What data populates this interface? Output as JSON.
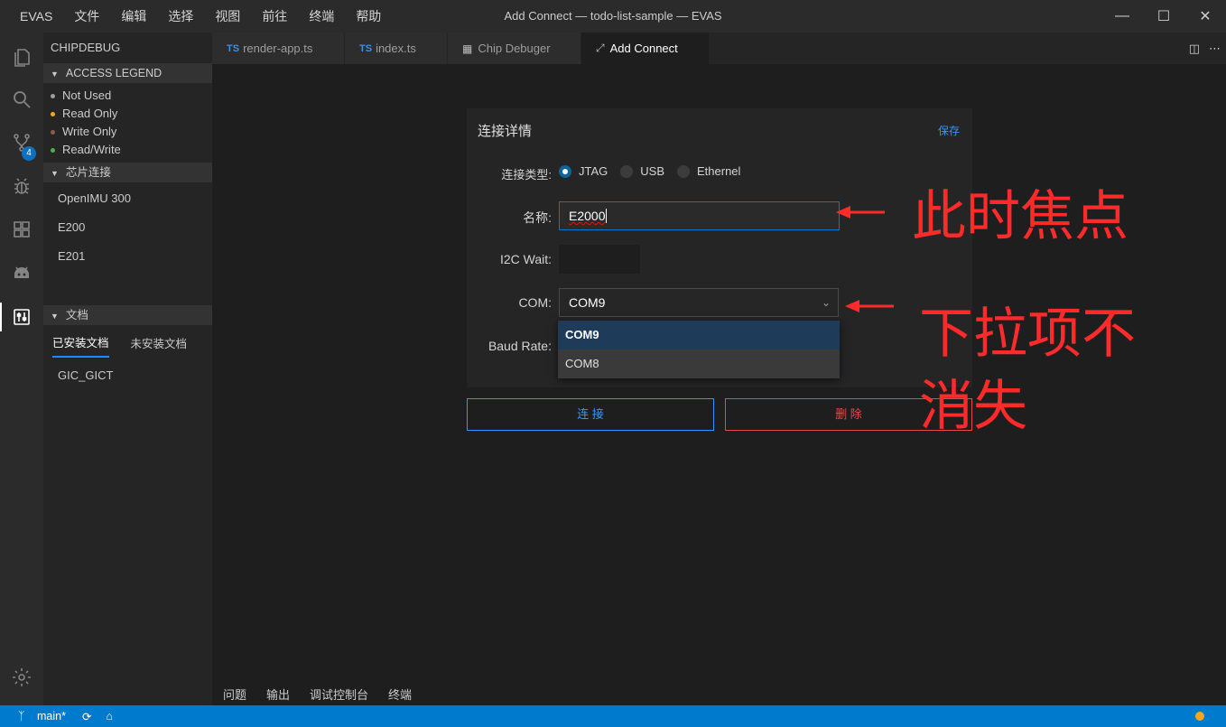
{
  "app": {
    "menu": [
      "EVAS",
      "文件",
      "编辑",
      "选择",
      "视图",
      "前往",
      "终端",
      "帮助"
    ],
    "window_title": "Add Connect — todo-list-sample — EVAS"
  },
  "activity_bar": {
    "scm_badge": "4",
    "icons": [
      "files-icon",
      "search-icon",
      "source-control-icon",
      "debug-icon",
      "extensions-icon",
      "android-icon",
      "chip-debug-icon",
      "settings-gear-icon"
    ]
  },
  "sidebar": {
    "title": "CHIPDEBUG",
    "legend_section": "ACCESS LEGEND",
    "legend": [
      {
        "label": "Not Used",
        "color": "#9e9e9e"
      },
      {
        "label": "Read Only",
        "color": "#f5a623"
      },
      {
        "label": "Write Only",
        "color": "#8b5a4a"
      },
      {
        "label": "Read/Write",
        "color": "#4caf50"
      }
    ],
    "chip_section": "芯片连接",
    "chips": [
      "OpenIMU 300",
      "E200",
      "E201"
    ],
    "docs_section": "文档",
    "doc_tabs": [
      "已安装文档",
      "未安装文档"
    ],
    "docs": [
      "GIC_GICT"
    ]
  },
  "tabs": [
    {
      "prefix": "TS",
      "label": "render-app.ts"
    },
    {
      "prefix": "TS",
      "label": "index.ts"
    },
    {
      "prefix": "▦",
      "label": "Chip Debuger"
    },
    {
      "prefix": "⤢",
      "label": "Add Connect"
    }
  ],
  "form": {
    "title": "连接详情",
    "save": "保存",
    "type_label": "连接类型:",
    "types": [
      "JTAG",
      "USB",
      "Ethernel"
    ],
    "selected_type": "JTAG",
    "name_label": "名称:",
    "name_value": "E2000",
    "i2c_label": "I2C Wait:",
    "i2c_value": "",
    "com_label": "COM:",
    "com_value": "COM9",
    "baud_label": "Baud Rate:",
    "com_options": [
      "COM9",
      "COM8"
    ],
    "connect_button": "连 接",
    "delete_button": "删 除"
  },
  "annotations": {
    "focus_note": "此时焦点",
    "dropdown_note_line1": "下拉项不",
    "dropdown_note_line2": "消失",
    "color": "#ff2b2b"
  },
  "panel_tabs": [
    "问题",
    "输出",
    "调试控制台",
    "终端"
  ],
  "statusbar": {
    "branch": "main*",
    "accent": "#007acc"
  }
}
